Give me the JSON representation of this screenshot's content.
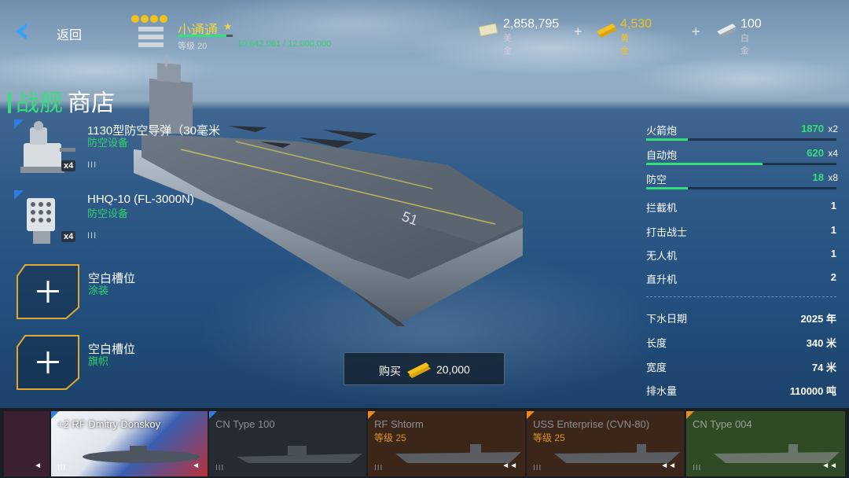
{
  "header": {
    "back_label": "返回",
    "player_name": "小通通",
    "level_label": "等级 20",
    "xp_text": "10,642,061 / 12,000,000",
    "xp_progress": 0.887
  },
  "currencies": [
    {
      "amount": "2,858,795",
      "label": "美金",
      "icon": "dollar-bill-icon",
      "color": "#ffffff"
    },
    {
      "amount": "4,530",
      "label": "黄金",
      "icon": "gold-bar-icon",
      "color": "#f2c21b"
    },
    {
      "amount": "100",
      "label": "白金",
      "icon": "platinum-bar-icon",
      "color": "#ffffff"
    }
  ],
  "title": {
    "part1": "战舰",
    "part2": "商店"
  },
  "equipment": [
    {
      "name": "1130型防空导弹（30毫米",
      "category": "防空设备",
      "count": "x4",
      "tier": "III",
      "icon": "ciws-turret-icon"
    },
    {
      "name": "HHQ-10 (FL-3000N)",
      "category": "防空设备",
      "count": "x4",
      "tier": "III",
      "icon": "missile-launcher-icon"
    }
  ],
  "empty_slots": [
    {
      "name": "空白槽位",
      "category": "涂装"
    },
    {
      "name": "空白槽位",
      "category": "旗帜"
    }
  ],
  "buy": {
    "label": "购买",
    "price": "20,000"
  },
  "weapons": [
    {
      "label": "火箭炮",
      "value": "1870",
      "mult": "x2",
      "fill": 0.22
    },
    {
      "label": "自动炮",
      "value": "620",
      "mult": "x4",
      "fill": 0.61
    },
    {
      "label": "防空",
      "value": "18",
      "mult": "x8",
      "fill": 0.22
    }
  ],
  "aircraft": [
    {
      "label": "拦截机",
      "value": "1"
    },
    {
      "label": "打击战士",
      "value": "1"
    },
    {
      "label": "无人机",
      "value": "1"
    },
    {
      "label": "直升机",
      "value": "2"
    }
  ],
  "specs": [
    {
      "label": "下水日期",
      "value": "2025 年"
    },
    {
      "label": "长度",
      "value": "340 米"
    },
    {
      "label": "宽度",
      "value": "74 米"
    },
    {
      "label": "排水量",
      "value": "110000 吨"
    }
  ],
  "carousel": [
    {
      "name": "+2 RF Dmitry Donskoy",
      "level": "",
      "tier": "III",
      "accent": "#2f7fe0",
      "state": "selected"
    },
    {
      "name": "CN Type 100",
      "level": "",
      "tier": "III",
      "accent": "#2f7fe0",
      "state": "normal"
    },
    {
      "name": "RF Shtorm",
      "level": "等级 25",
      "tier": "III",
      "accent": "#f08a1a",
      "state": "locked"
    },
    {
      "name": "USS Enterprise (CVN-80)",
      "level": "等级 25",
      "tier": "III",
      "accent": "#f08a1a",
      "state": "locked"
    },
    {
      "name": "CN Type 004",
      "level": "",
      "tier": "III",
      "accent": "#f08a1a",
      "state": "green"
    }
  ]
}
